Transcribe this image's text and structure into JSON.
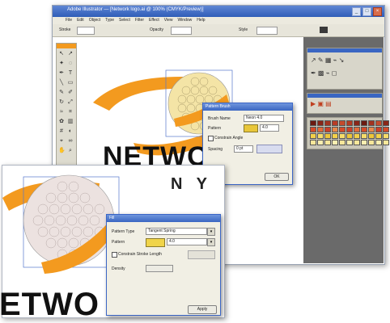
{
  "back_window": {
    "title": "Adobe Illustrator — [Network logo.ai @ 100% (CMYK/Preview)]",
    "menu": [
      "File",
      "Edit",
      "Object",
      "Type",
      "Select",
      "Filter",
      "Effect",
      "View",
      "Window",
      "Help"
    ],
    "options_bar": [
      "Stroke",
      "Opacity",
      "Style"
    ],
    "logo_text": "NETWO",
    "dialog": {
      "title": "Pattern Brush",
      "label_1": "Brush Name",
      "value_1": "Neon 4.0",
      "label_2": "Pattern",
      "value_2": "4.0",
      "checkbox_label": "Constrain Angle",
      "label_3": "Spacing",
      "value_3": "0 pt",
      "button": "OK"
    }
  },
  "front_window": {
    "logo_text_1": "ETWO",
    "logo_text_2": "N Y",
    "dialog": {
      "title": "Fill",
      "label_1": "Pattern Type",
      "value_1": "Tangent Spring",
      "label_2": "Pattern",
      "value_2": "4.0",
      "checkbox_label": "Constrain Stroke Length",
      "label_3": "Density",
      "value_3": "",
      "button": "Apply"
    }
  },
  "colors": {
    "orange": "#f39a1f",
    "yellow_circle": "#f4e4a6",
    "pink_circle": "#ece2e0",
    "gray_bg": "#6a6a6a",
    "accent_blue": "#2f5db8"
  }
}
